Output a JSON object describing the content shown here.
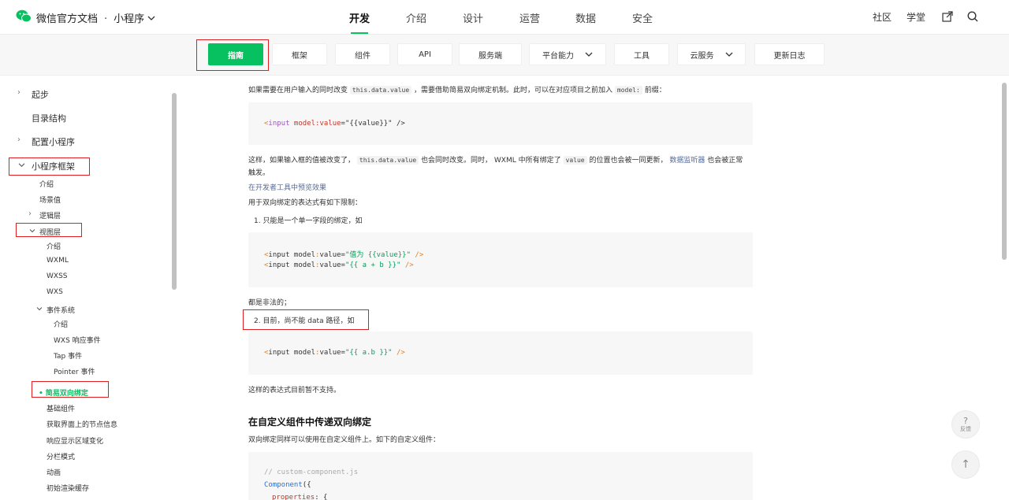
{
  "header": {
    "brand": "微信官方文档",
    "sep": "·",
    "product": "小程序",
    "nav": [
      "开发",
      "介绍",
      "设计",
      "运营",
      "数据",
      "安全"
    ],
    "active_nav": "开发",
    "right_links": [
      "社区",
      "学堂"
    ],
    "icons": [
      "logo-icon",
      "chevron-down-icon",
      "open-external-icon",
      "search-icon"
    ]
  },
  "subnav": {
    "tabs": [
      {
        "label": "指南",
        "active": true
      },
      {
        "label": "框架"
      },
      {
        "label": "组件"
      },
      {
        "label": "API"
      },
      {
        "label": "服务端"
      },
      {
        "label": "平台能力",
        "dropdown": true
      },
      {
        "label": "工具"
      },
      {
        "label": "云服务",
        "dropdown": true
      },
      {
        "label": "更新日志"
      }
    ]
  },
  "sidebar": {
    "items": [
      {
        "label": "起步"
      },
      {
        "label": "目录结构"
      },
      {
        "label": "配置小程序"
      },
      {
        "label": "小程序框架"
      },
      {
        "label": "介绍"
      },
      {
        "label": "场景值"
      },
      {
        "label": "逻辑层"
      },
      {
        "label": "视图层"
      },
      {
        "label": "介绍"
      },
      {
        "label": "WXML"
      },
      {
        "label": "WXSS"
      },
      {
        "label": "WXS"
      },
      {
        "label": "事件系统"
      },
      {
        "label": "介绍"
      },
      {
        "label": "WXS 响应事件"
      },
      {
        "label": "Tap 事件"
      },
      {
        "label": "Pointer 事件"
      },
      {
        "label": "• 简易双向绑定"
      },
      {
        "label": "基础组件"
      },
      {
        "label": "获取界面上的节点信息"
      },
      {
        "label": "响应显示区域变化"
      },
      {
        "label": "分栏模式"
      },
      {
        "label": "动画"
      },
      {
        "label": "初始渲染缓存"
      }
    ]
  },
  "content": {
    "p1_a": "如果需要在用户输入的同时改变",
    "p1_code1": "this.data.value",
    "p1_b": "，需要借助简易双向绑定机制。此时，可以在对应项目之前加入",
    "p1_code2": "model:",
    "p1_c": "前缀：",
    "code1": {
      "lt": "<",
      "tag": "input",
      "attr": " model:value",
      "eq": "=",
      "val": "\"{{value}}\"",
      "end": " />"
    },
    "p2_a": "这样，如果输入框的值被改变了，",
    "p2_code1": "this.data.value",
    "p2_b": "也会同时改变。同时，",
    "p2_c": "WXML 中所有绑定了",
    "p2_code2": "value",
    "p2_d": "的位置也会被一同更新，",
    "p2_link": "数据监听器",
    "p2_e": "也会被正常",
    "p2_f": "触发。",
    "link_preview": "在开发者工具中预览效果",
    "p3": "用于双向绑定的表达式有如下限制：",
    "li1": "1. 只能是一个单一字段的绑定，如",
    "code2_line1": {
      "lt": "<",
      "tag": "input model",
      "colon": ":",
      "attr": "value",
      "eq": "=",
      "val": "\"值为 {{value}}\"",
      "end": " />"
    },
    "code2_line2": {
      "lt": "<",
      "tag": "input model",
      "colon": ":",
      "attr": "value",
      "eq": "=",
      "val": "\"{{ a + b }}\"",
      "end": " />"
    },
    "p4": "都是非法的；",
    "li2": "2. 目前，尚不能 data 路径，如",
    "code3_line1": {
      "lt": "<",
      "tag": "input model",
      "colon": ":",
      "attr": "value",
      "eq": "=",
      "val": "\"{{ a.b }}\"",
      "end": " />"
    },
    "p5": "这样的表达式目前暂不支持。",
    "h3": "在自定义组件中传递双向绑定",
    "p6": "双向绑定同样可以使用在自定义组件上。如下的自定义组件：",
    "code4_comment": "// custom-component.js",
    "code4_fn": "Component",
    "code4_paren": "({",
    "code4_prop": "properties",
    "code4_rest": ": {"
  },
  "floating": {
    "feedback_symbol": "?",
    "feedback_label": "反馈",
    "top_symbol": "↑"
  }
}
